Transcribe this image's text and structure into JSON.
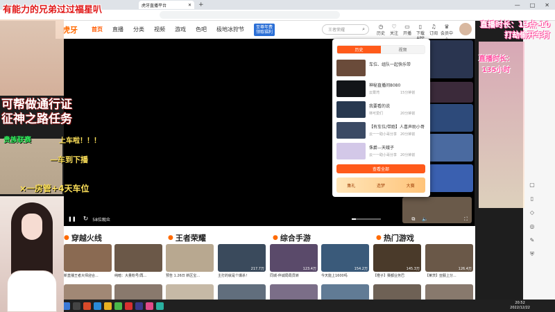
{
  "browser": {
    "tab_title": "虎牙直播平台",
    "new_tab": "+",
    "window_controls": [
      "—",
      "□",
      "✕"
    ]
  },
  "site": {
    "logo": "虎牙",
    "nav": [
      "首页",
      "直播",
      "分类",
      "视频",
      "游戏",
      "色吧",
      "极地冰狩节"
    ],
    "promo": [
      "至尊年费",
      "领取福利"
    ],
    "search_placeholder": "王者荣耀",
    "header_icons": [
      {
        "label": "历史",
        "icon": "clock-icon"
      },
      {
        "label": "关注",
        "icon": "heart-icon"
      },
      {
        "label": "开播",
        "icon": "camera-icon"
      },
      {
        "label": "下载APP",
        "icon": "phone-icon"
      },
      {
        "label": "订阅",
        "icon": "bell-icon"
      },
      {
        "label": "会员中心",
        "icon": "vip-icon"
      },
      {
        "label": "任务",
        "icon": "task-icon"
      }
    ]
  },
  "player": {
    "play": "❚❚",
    "refresh": "↻",
    "viewers": "58位观众",
    "pip": "⧉",
    "volume": "🔈",
    "volume_level": 0.15,
    "fullscreen": "⛶"
  },
  "history_popup": {
    "tabs": [
      "历史",
      "视频"
    ],
    "active_tab": 0,
    "items": [
      {
        "title": "车位、组队一起快乐带",
        "author": "",
        "ago": "",
        "thumb": "#6a4b3a"
      },
      {
        "title": "神秘直播间8080",
        "author": "云霄湾",
        "ago": "15分钟前",
        "thumb": "#121418"
      },
      {
        "title": "我要看的说",
        "author": "林可爱们",
        "ago": "20分钟前",
        "thumb": "#27384f"
      },
      {
        "title": "【有车位/带跑】人喜声助小哥...",
        "author": "云一一助小哥分享",
        "ago": "20分钟前",
        "thumb": "#3b4a64"
      },
      {
        "title": "侏爵—天蛾子",
        "author": "云一一助小哥分享",
        "ago": "20分钟前",
        "thumb": "#d3c8e8"
      }
    ],
    "view_all": "查看全部",
    "banner": [
      "集礼",
      "造梦",
      "大赛"
    ]
  },
  "categories": [
    {
      "name": "穿越火线",
      "icon": "fire-icon"
    },
    {
      "name": "王者荣耀",
      "icon": "crown-icon"
    },
    {
      "name": "综合手游",
      "icon": "gamepad-icon"
    },
    {
      "name": "热门游戏",
      "icon": "controller-icon"
    }
  ],
  "cards": [
    {
      "caption": "新直播王者大师迎合...",
      "stat": "",
      "color": "#8a6a52"
    },
    {
      "caption": "纯暗：大量粉号/再...",
      "stat": "",
      "color": "#6b5848"
    },
    {
      "caption": "预告 1.26日 新区宝...",
      "stat": "",
      "color": "#b8a890"
    },
    {
      "caption": "主打的就是个爆杀！",
      "stat": "217.7万",
      "color": "#3a4a5c"
    },
    {
      "caption": "同城-伴诚局局员转",
      "stat": "123.4万",
      "color": "#5a4a6a"
    },
    {
      "caption": "今天能上1600吗",
      "stat": "154.2万",
      "color": "#3a5a7a"
    },
    {
      "caption": "【橙子】赛都业务巴",
      "stat": "145.3万",
      "color": "#4a3a2a"
    },
    {
      "caption": "【莱茨】亚服上分...",
      "stat": "126.4万",
      "color": "#6a5848"
    }
  ],
  "taskbar": {
    "time": "20:52",
    "date": "2022/12/22"
  },
  "overlays": {
    "title": "有能力的兄弟过过福星叭",
    "line1": "可帮做通行证",
    "line2": "征神之路任务",
    "line3": "贵族联赛",
    "line3b": "上车啦！！！",
    "line4": "—车到下播",
    "line5": "×一房管+4天车位",
    "right1": "直播时长：13点-10",
    "right2": "打劫偷开车打",
    "right3": "直播时长：",
    "right4": "135小时"
  },
  "colors": {
    "brand": "#ff5a1a",
    "player_bg": "#000000"
  }
}
